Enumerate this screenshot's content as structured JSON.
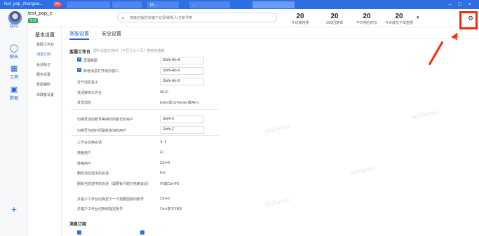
{
  "titlebar": {
    "window_title": "test_pop_zhangxia...",
    "tabs": [
      {
        "label": "...",
        "badge": "99+"
      },
      {
        "label": "...",
        "badge": ""
      },
      {
        "label": "po...",
        "badge": ""
      },
      {
        "label": "...",
        "badge": ""
      },
      {
        "label": "...",
        "badge": ""
      }
    ]
  },
  "sidebar": {
    "items": [
      {
        "label": "接待",
        "icon": "chat-bubble-icon"
      },
      {
        "label": "聊天",
        "icon": "message-icon"
      },
      {
        "label": "工具",
        "icon": "grid-tools-icon"
      },
      {
        "label": "数据",
        "icon": "calendar-icon"
      }
    ],
    "add_label": "+"
  },
  "user": {
    "name": "test_pop_z",
    "status": "在线"
  },
  "search": {
    "placeholder": "搜索店铺咨询/客户记录/联系人/订单号等"
  },
  "stats": [
    {
      "value": "20",
      "label": "今日接待量"
    },
    {
      "value": "20",
      "label": "30S回复率"
    },
    {
      "value": "20",
      "label": "平均响应时长"
    },
    {
      "value": "20",
      "label": "今日成交下单金额"
    }
  ],
  "dropdown_arrow": "▾",
  "settings_icon": "gear-icon",
  "menu": {
    "header": "基本设置",
    "items": [
      "客服工作台",
      "消息订阅",
      "会话标记",
      "服务设置",
      "智能辅助",
      "未联客设置"
    ]
  },
  "tabs": [
    {
      "label": "客服设置",
      "active": true
    },
    {
      "label": "安全设置",
      "active": false
    }
  ],
  "section": {
    "title": "客服工作台",
    "hint": "即时设置支持AZ（不区分大小写）表格快捷键"
  },
  "shortcuts": [
    {
      "label": "屏幕截图",
      "value": "Shift+Alt+A",
      "checked": true,
      "boxed": true
    },
    {
      "label": "新增消息打开待办窗口",
      "value": "Shift+Alt+S",
      "checked": true,
      "boxed": true
    },
    {
      "label": "打开消息盒子",
      "value": "Shift+Alt+X",
      "checked": false,
      "boxed": true
    },
    {
      "label": "关闭接待工作台",
      "value": "Alt+C",
      "checked": false,
      "boxed": false
    },
    {
      "label": "发送消息",
      "value": "Enter或Ctrl+Enter或Alt+s",
      "checked": false,
      "boxed": false
    },
    {
      "label": "切换至当前账号等待时间最长的用户",
      "value": "Shift+X",
      "checked": false,
      "boxed": true
    },
    {
      "label": "切换至当前时间最新咨询的用户",
      "value": "Shift+Z",
      "checked": false,
      "boxed": true
    },
    {
      "label": "工作台切换会话",
      "value": "⬆ ⬇",
      "checked": false,
      "boxed": false
    },
    {
      "label": "搜索用户",
      "value": "F1",
      "checked": false,
      "boxed": false
    },
    {
      "label": "转接用户",
      "value": "Ctrl+R",
      "checked": false,
      "boxed": false
    },
    {
      "label": "删除当前选中的会话",
      "value": "Esc",
      "checked": false,
      "boxed": false
    },
    {
      "label": "删除当前选中的会话（需要有问题已结束会话）",
      "value": "F6或Ctrl+F6",
      "checked": false,
      "boxed": false
    },
    {
      "label": "多客户工作台切换至下一个需要回复的账号",
      "value": "Ctrl+D",
      "checked": false,
      "boxed": false
    },
    {
      "label": "多客户工作台切换到指定账号",
      "value": "Ctrl+数字1到9",
      "checked": false,
      "boxed": false
    }
  ],
  "section2": {
    "title": "消息订阅"
  },
  "watermarks": [
    "tmlhenn",
    "tmlhenn",
    "tmlhenn",
    "tmlhenn"
  ]
}
